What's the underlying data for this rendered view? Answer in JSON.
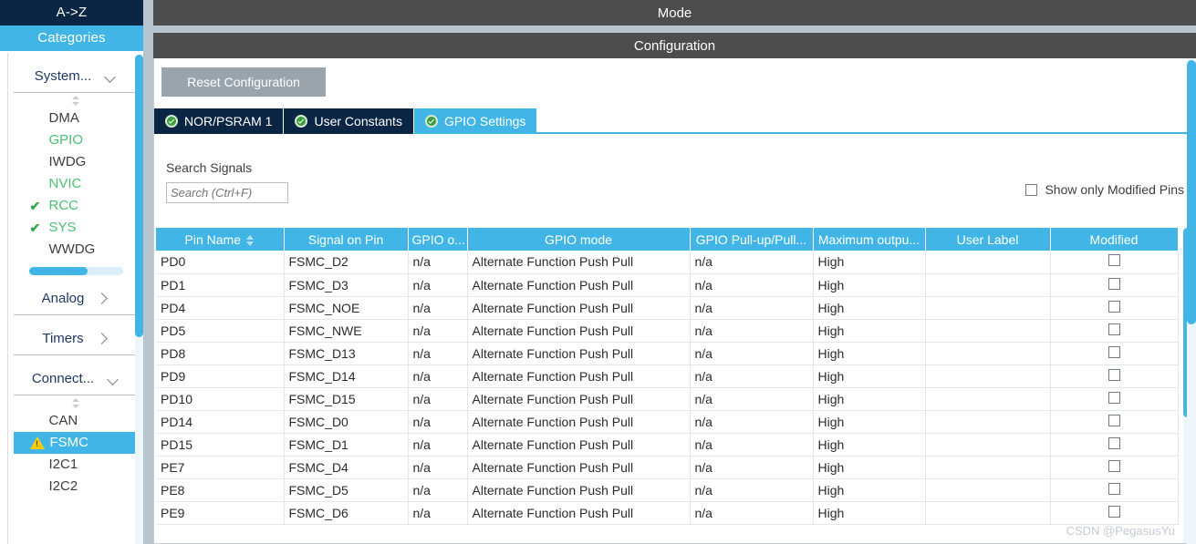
{
  "sidebar": {
    "tabs": [
      {
        "label": "A->Z",
        "name": "tab-a-to-z",
        "active": false
      },
      {
        "label": "Categories",
        "name": "tab-categories",
        "active": true
      }
    ],
    "groups": [
      {
        "label": "System...",
        "expanded": true,
        "chevron": "chevron-down-icon",
        "items": [
          {
            "label": "DMA",
            "state": "plain",
            "check": false
          },
          {
            "label": "GPIO",
            "state": "green",
            "check": false
          },
          {
            "label": "IWDG",
            "state": "plain",
            "check": false
          },
          {
            "label": "NVIC",
            "state": "green",
            "check": false
          },
          {
            "label": "RCC",
            "state": "green",
            "check": true
          },
          {
            "label": "SYS",
            "state": "green",
            "check": true
          },
          {
            "label": "WWDG",
            "state": "plain",
            "check": false
          }
        ]
      },
      {
        "label": "Analog",
        "expanded": false,
        "chevron": "chevron-right-icon",
        "items": []
      },
      {
        "label": "Timers",
        "expanded": false,
        "chevron": "chevron-right-icon",
        "items": []
      },
      {
        "label": "Connect...",
        "expanded": true,
        "chevron": "chevron-down-icon",
        "items": [
          {
            "label": "CAN",
            "state": "plain",
            "check": false
          },
          {
            "label": "FSMC",
            "state": "selected",
            "check": false,
            "warning": true
          },
          {
            "label": "I2C1",
            "state": "plain",
            "check": false
          },
          {
            "label": "I2C2",
            "state": "plain",
            "check": false
          }
        ]
      }
    ]
  },
  "header": {
    "mode_title": "Mode",
    "configuration_title": "Configuration"
  },
  "toolbar": {
    "reset_label": "Reset Configuration"
  },
  "tabs": [
    {
      "label": "NOR/PSRAM 1",
      "name": "tab-nor-psram-1",
      "active": false,
      "icon": "ok-check-icon"
    },
    {
      "label": "User Constants",
      "name": "tab-user-constants",
      "active": false,
      "icon": "ok-check-icon"
    },
    {
      "label": "GPIO Settings",
      "name": "tab-gpio-settings",
      "active": true,
      "icon": "ok-check-icon"
    }
  ],
  "search": {
    "label": "Search Signals",
    "placeholder": "Search (Ctrl+F)",
    "value": ""
  },
  "filter": {
    "show_only_modified_label": "Show only Modified Pins",
    "checked": false
  },
  "table": {
    "columns": [
      "Pin Name",
      "Signal on Pin",
      "GPIO o...",
      "GPIO mode",
      "GPIO Pull-up/Pull...",
      "Maximum outpu...",
      "User Label",
      "Modified"
    ],
    "sorted_column": "Pin Name",
    "rows": [
      {
        "pin": "PD0",
        "signal": "FSMC_D2",
        "output": "n/a",
        "mode": "Alternate Function Push Pull",
        "pull": "n/a",
        "speed": "High",
        "label": "",
        "modified": false
      },
      {
        "pin": "PD1",
        "signal": "FSMC_D3",
        "output": "n/a",
        "mode": "Alternate Function Push Pull",
        "pull": "n/a",
        "speed": "High",
        "label": "",
        "modified": false
      },
      {
        "pin": "PD4",
        "signal": "FSMC_NOE",
        "output": "n/a",
        "mode": "Alternate Function Push Pull",
        "pull": "n/a",
        "speed": "High",
        "label": "",
        "modified": false
      },
      {
        "pin": "PD5",
        "signal": "FSMC_NWE",
        "output": "n/a",
        "mode": "Alternate Function Push Pull",
        "pull": "n/a",
        "speed": "High",
        "label": "",
        "modified": false
      },
      {
        "pin": "PD8",
        "signal": "FSMC_D13",
        "output": "n/a",
        "mode": "Alternate Function Push Pull",
        "pull": "n/a",
        "speed": "High",
        "label": "",
        "modified": false
      },
      {
        "pin": "PD9",
        "signal": "FSMC_D14",
        "output": "n/a",
        "mode": "Alternate Function Push Pull",
        "pull": "n/a",
        "speed": "High",
        "label": "",
        "modified": false
      },
      {
        "pin": "PD10",
        "signal": "FSMC_D15",
        "output": "n/a",
        "mode": "Alternate Function Push Pull",
        "pull": "n/a",
        "speed": "High",
        "label": "",
        "modified": false
      },
      {
        "pin": "PD14",
        "signal": "FSMC_D0",
        "output": "n/a",
        "mode": "Alternate Function Push Pull",
        "pull": "n/a",
        "speed": "High",
        "label": "",
        "modified": false
      },
      {
        "pin": "PD15",
        "signal": "FSMC_D1",
        "output": "n/a",
        "mode": "Alternate Function Push Pull",
        "pull": "n/a",
        "speed": "High",
        "label": "",
        "modified": false
      },
      {
        "pin": "PE7",
        "signal": "FSMC_D4",
        "output": "n/a",
        "mode": "Alternate Function Push Pull",
        "pull": "n/a",
        "speed": "High",
        "label": "",
        "modified": false
      },
      {
        "pin": "PE8",
        "signal": "FSMC_D5",
        "output": "n/a",
        "mode": "Alternate Function Push Pull",
        "pull": "n/a",
        "speed": "High",
        "label": "",
        "modified": false
      },
      {
        "pin": "PE9",
        "signal": "FSMC_D6",
        "output": "n/a",
        "mode": "Alternate Function Push Pull",
        "pull": "n/a",
        "speed": "High",
        "label": "",
        "modified": false
      }
    ]
  },
  "watermark": "CSDN @PegasusYu",
  "colors": {
    "accent": "#41b6e6",
    "dark_navy": "#0b2545",
    "bar_gray": "#4d4d4d",
    "panel_bg": "#b8c4ce",
    "green_text": "#4bbf73",
    "warning_yellow": "#ffcc00"
  }
}
